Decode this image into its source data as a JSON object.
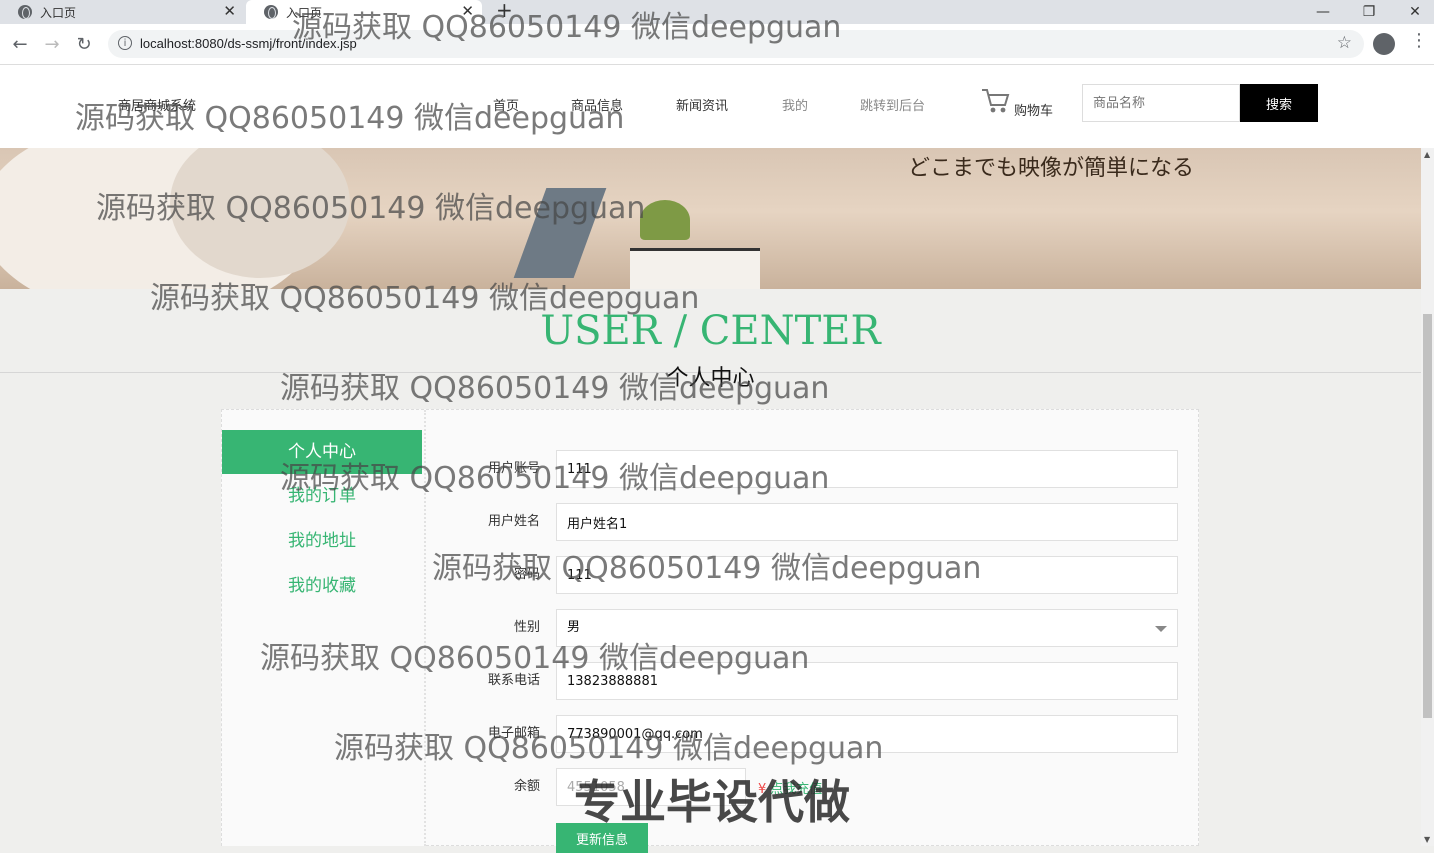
{
  "browser": {
    "tabs": [
      {
        "title": "入口页",
        "active": false
      },
      {
        "title": "入口页",
        "active": true
      }
    ],
    "url": "localhost:8080/ds-ssmj/front/index.jsp"
  },
  "header": {
    "brand": "商居商城系统",
    "nav": [
      "首页",
      "商品信息",
      "新闻资讯",
      "我的",
      "跳转到后台"
    ],
    "cart_label": "购物车",
    "search_placeholder": "商品名称",
    "search_button": "搜索"
  },
  "banner": {
    "japanese_text": "どこまでも映像が簡単になる"
  },
  "section": {
    "title_en": "USER / CENTER",
    "title_cn": "个人中心"
  },
  "sidebar": {
    "items": [
      "个人中心",
      "我的订单",
      "我的地址",
      "我的收藏"
    ],
    "active_index": 0
  },
  "form": {
    "fields": [
      {
        "label": "用户账号",
        "value": "111"
      },
      {
        "label": "用户姓名",
        "value": "用户姓名1"
      },
      {
        "label": "密码",
        "value": "111"
      },
      {
        "label": "性别",
        "value": "男"
      },
      {
        "label": "联系电话",
        "value": "13823888881"
      },
      {
        "label": "电子邮箱",
        "value": "773890001@qq.com"
      },
      {
        "label": "余额",
        "value": "4551058"
      }
    ],
    "recharge_label": "点我充值",
    "update_button": "更新信息"
  },
  "watermark": {
    "text": "源码获取 QQ86050149 微信deepguan",
    "stamp": "专业毕设代做"
  },
  "colors": {
    "accent": "#37b573",
    "search_button": "#000000"
  }
}
